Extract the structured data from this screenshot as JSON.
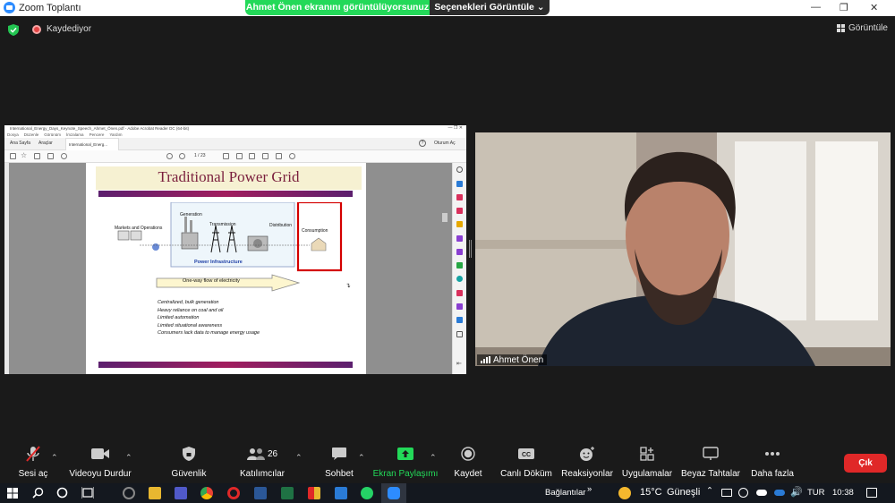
{
  "window": {
    "title": "Zoom Toplantı",
    "share_banner": "Ahmet Önen ekranını görüntülüyorsunuz",
    "view_options": "Seçenekleri Görüntüle",
    "recording_label": "Kaydediyor",
    "view_label": "Görüntüle"
  },
  "shared_screen": {
    "app_title": "International_Energy_Days_Keynote_Speech_Ahmet_Önen.pdf - Adobe Acrobat Reader DC (64-bit)",
    "menu": [
      "Dosya",
      "Düzenle",
      "Görünüm",
      "İmzalama",
      "Pencere",
      "Yardım"
    ],
    "tabs": [
      "Ana Sayfa",
      "Araçlar",
      "International_Energ..."
    ],
    "sign_in": "Oturum Aç",
    "page_indicator": "1 / 23",
    "slide": {
      "title": "Traditional Power Grid",
      "labels": {
        "markets": "Markets and Operations",
        "generation": "Generation",
        "transmission": "Transmission",
        "distribution": "Distribution",
        "consumption": "Consumption",
        "infrastructure": "Power Infrastructure",
        "flow": "One-way flow of electricity"
      },
      "bullets": [
        "Centralized, bulk generation",
        "Heavy reliance on coal and oil",
        "Limited automation",
        "Limited situational awareness",
        "Consumers lack data to manage energy usage"
      ],
      "accent": "#7a1f3d",
      "highlight": "#d40000"
    }
  },
  "participant": {
    "name": "Ahmet Önen"
  },
  "toolbar": {
    "mute": "Sesi aç",
    "video": "Videoyu Durdur",
    "security": "Güvenlik",
    "participants": "Katılımcılar",
    "participant_count": "26",
    "chat": "Sohbet",
    "share": "Ekran Paylaşımı",
    "record": "Kaydet",
    "captions": "Canlı Döküm",
    "reactions": "Reaksiyonlar",
    "apps": "Uygulamalar",
    "whiteboard": "Beyaz Tahtalar",
    "more": "Daha fazla",
    "leave": "Çık",
    "share_color": "#23d959",
    "leave_color": "#e02828"
  },
  "taskbar": {
    "links": "Bağlantılar",
    "weather_temp": "15°C",
    "weather_text": "Güneşli",
    "language": "TUR",
    "time": "10:38"
  }
}
